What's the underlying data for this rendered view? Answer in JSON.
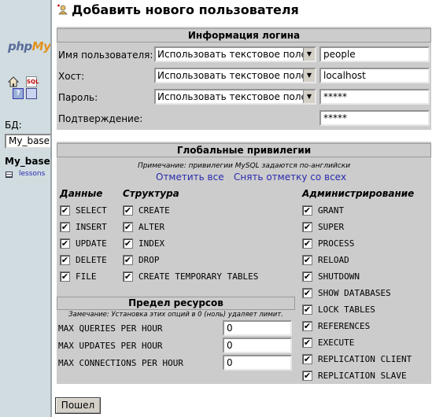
{
  "nav": {
    "logo_prefix": "php",
    "logo_suffix": "My",
    "sql_icon_text": "SQL",
    "query_icon_text": "?",
    "db_label": "БД:",
    "db_select_value": "My_base",
    "db_name": "My_base",
    "table_link": "lessons"
  },
  "page": {
    "title": "Добавить нового пользователя"
  },
  "login": {
    "header": "Информация логина",
    "rows": [
      {
        "label": "Имя пользователя:",
        "select": "Использовать текстовое поле:",
        "value": "people"
      },
      {
        "label": "Хост:",
        "select": "Использовать текстовое поле:",
        "value": "localhost"
      },
      {
        "label": "Пароль:",
        "select": "Использовать текстовое поле:",
        "value": "*****"
      },
      {
        "label": "Подтверждение:",
        "value": "*****"
      }
    ]
  },
  "privileges": {
    "header": "Глобальные привилегии",
    "note": "Примечание: привилегии MySQL задаются по-английски",
    "check_all": "Отметить все",
    "uncheck_all": "Снять отметку со всех",
    "data_header": "Данные",
    "structure_header": "Структура",
    "admin_header": "Администрирование",
    "data": [
      "SELECT",
      "INSERT",
      "UPDATE",
      "DELETE",
      "FILE"
    ],
    "structure": [
      "CREATE",
      "ALTER",
      "INDEX",
      "DROP",
      "CREATE TEMPORARY TABLES"
    ],
    "admin": [
      "GRANT",
      "SUPER",
      "PROCESS",
      "RELOAD",
      "SHUTDOWN",
      "SHOW DATABASES",
      "LOCK TABLES",
      "REFERENCES",
      "EXECUTE",
      "REPLICATION CLIENT",
      "REPLICATION SLAVE"
    ],
    "check_mark": "✔"
  },
  "resources": {
    "header": "Предел ресурсов",
    "note": "Замечание: Установка этих опций в 0 (ноль) удаляет лимит.",
    "rows": [
      {
        "label": "MAX QUERIES PER HOUR",
        "value": "0"
      },
      {
        "label": "MAX UPDATES PER HOUR",
        "value": "0"
      },
      {
        "label": "MAX CONNECTIONS PER HOUR",
        "value": "0"
      }
    ]
  },
  "actions": {
    "go_label": "Пошел"
  }
}
